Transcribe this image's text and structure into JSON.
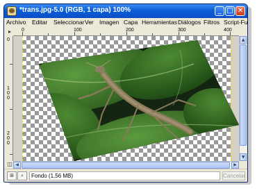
{
  "window": {
    "title": "*trans.jpg-5.0 (RGB, 1 capa) 100%",
    "minimize": "_",
    "maximize": "□",
    "close": "✕"
  },
  "menu": [
    "Archivo",
    "Editar",
    "Seleccionar",
    "Ver",
    "Imagen",
    "Capa",
    "Herramientas",
    "Diálogos",
    "Filtros",
    "Script-Fu"
  ],
  "ruler": {
    "top_labels": [
      "0",
      "100",
      "200",
      "300",
      "400"
    ],
    "left_labels": [
      "0",
      "100",
      "200"
    ],
    "corner_icon": "arrow-icon"
  },
  "status": {
    "text": "Fondo (1,56 MB)",
    "cancel": "Cancelar",
    "unit_icon": "ruler-unit-icon",
    "zoom_icon": "zoom-icon"
  },
  "colors": {
    "title_bar": "#0a5fd8",
    "close_button": "#c93a18",
    "leaf_green": "#3f7a2a",
    "mantis_brown": "#8b7a5a"
  }
}
